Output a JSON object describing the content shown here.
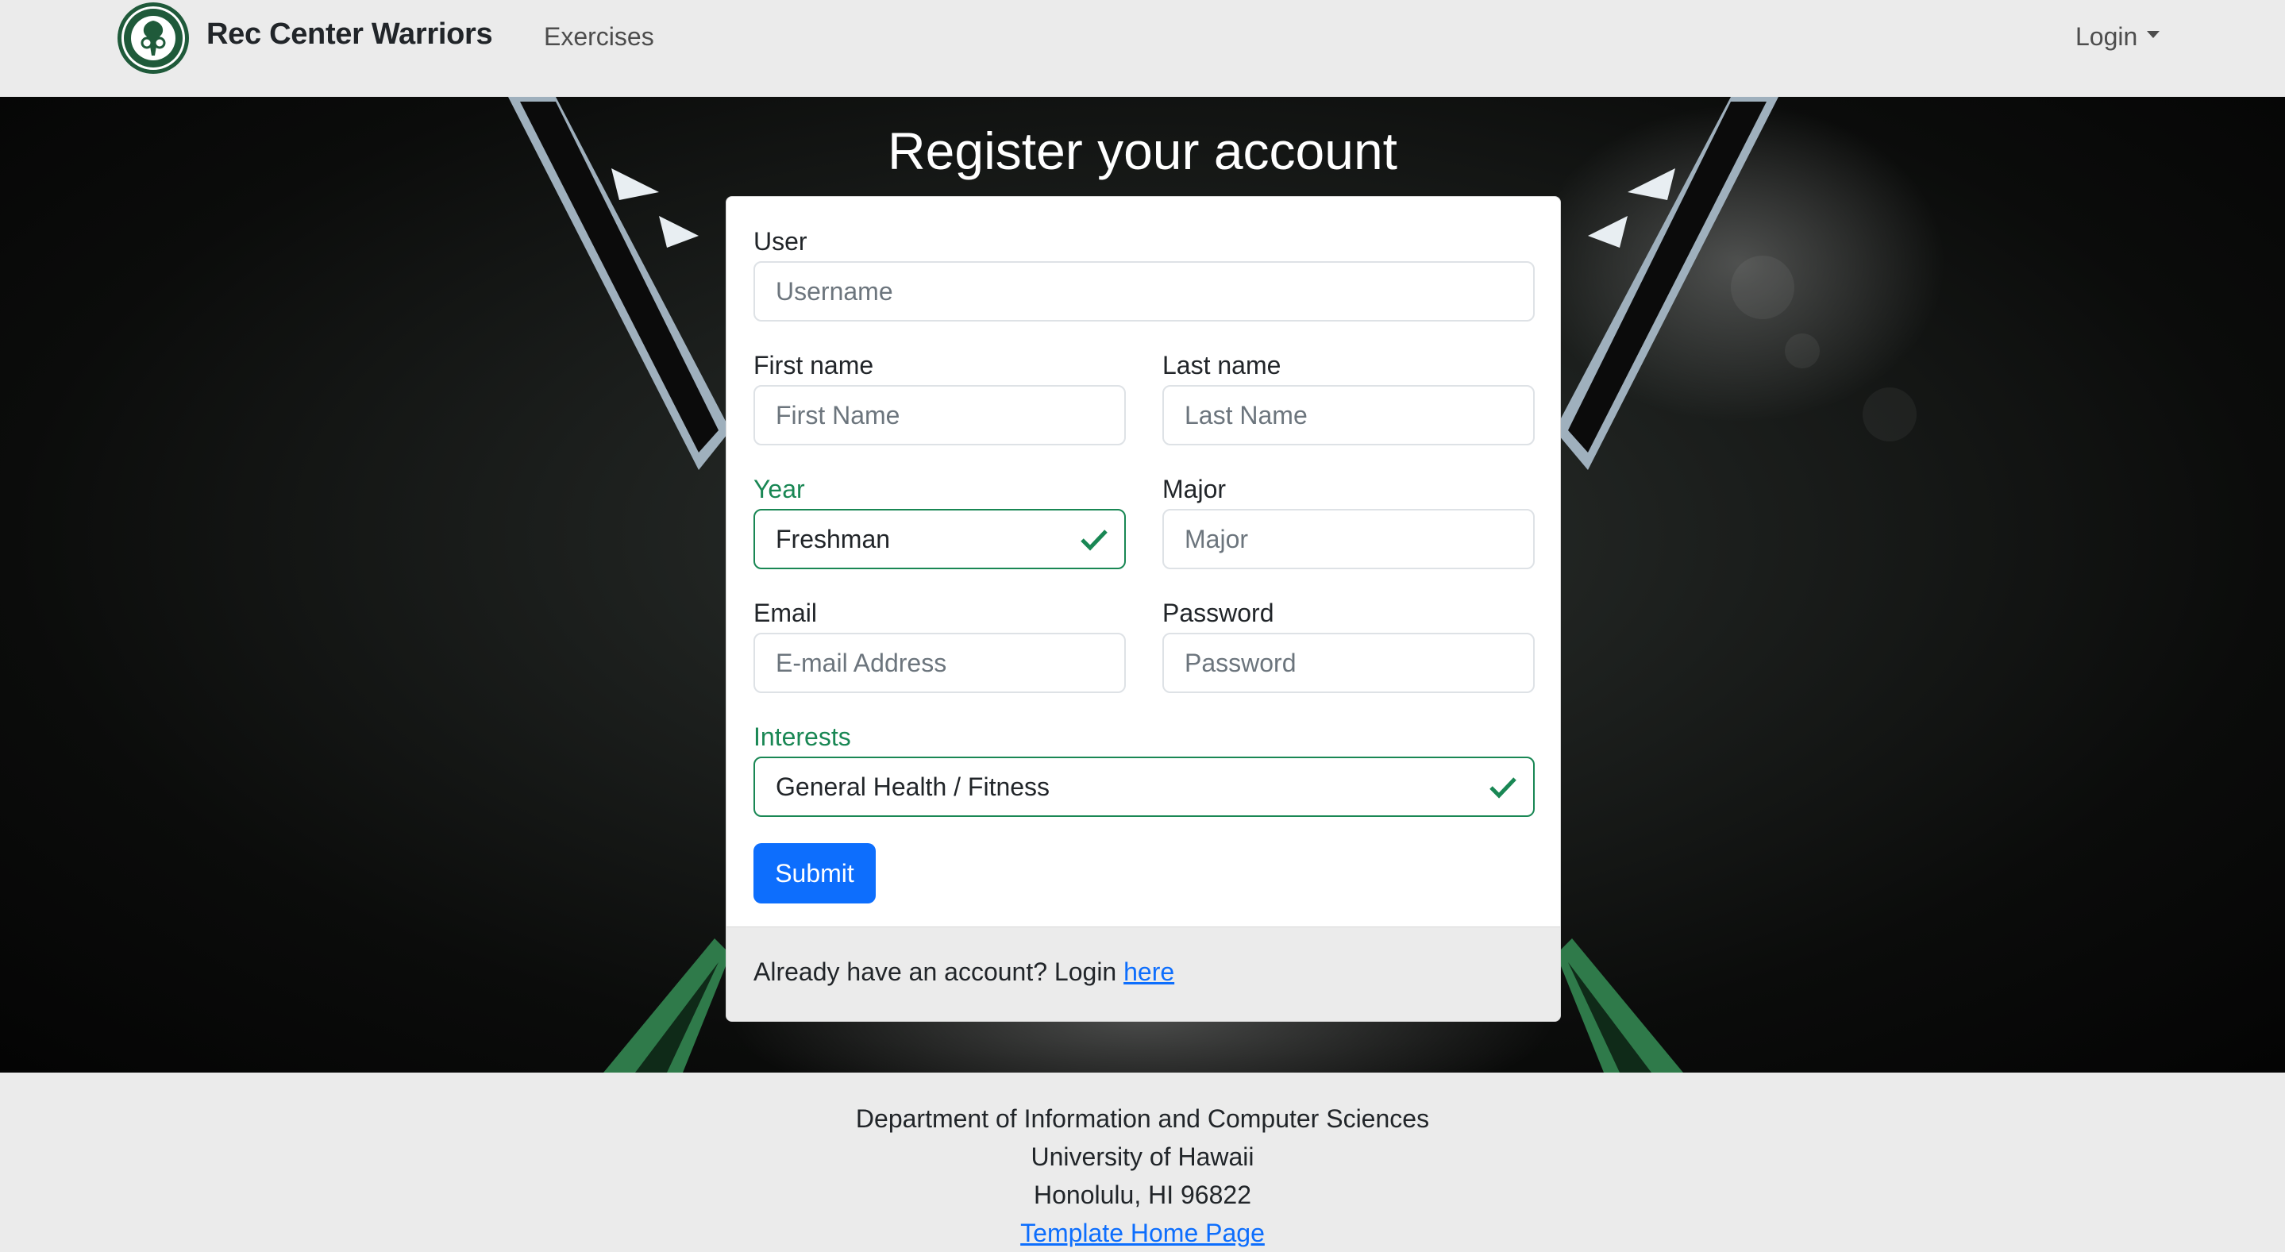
{
  "navbar": {
    "brand": "Rec Center Warriors",
    "exercises_link": "Exercises",
    "login_dropdown": "Login"
  },
  "hero": {
    "title": "Register your account"
  },
  "form": {
    "user": {
      "label": "User",
      "placeholder": "Username"
    },
    "first_name": {
      "label": "First name",
      "placeholder": "First Name"
    },
    "last_name": {
      "label": "Last name",
      "placeholder": "Last Name"
    },
    "year": {
      "label": "Year",
      "value": "Freshman",
      "state": "valid"
    },
    "major": {
      "label": "Major",
      "placeholder": "Major"
    },
    "email": {
      "label": "Email",
      "placeholder": "E-mail Address"
    },
    "password": {
      "label": "Password",
      "placeholder": "Password"
    },
    "interests": {
      "label": "Interests",
      "value": "General Health / Fitness",
      "state": "valid"
    },
    "submit_label": "Submit",
    "footer_text": "Already have an account? Login ",
    "footer_link": "here"
  },
  "page_footer": {
    "line1": "Department of Information and Computer Sciences",
    "line2": "University of Hawaii",
    "line3": "Honolulu, HI 96822",
    "link": "Template Home Page"
  },
  "colors": {
    "primary": "#0d6efd",
    "valid": "#198754",
    "navbar_bg": "#ebebeb"
  },
  "icons": [
    "logo-seal-icon",
    "caret-down-icon",
    "check-icon"
  ]
}
